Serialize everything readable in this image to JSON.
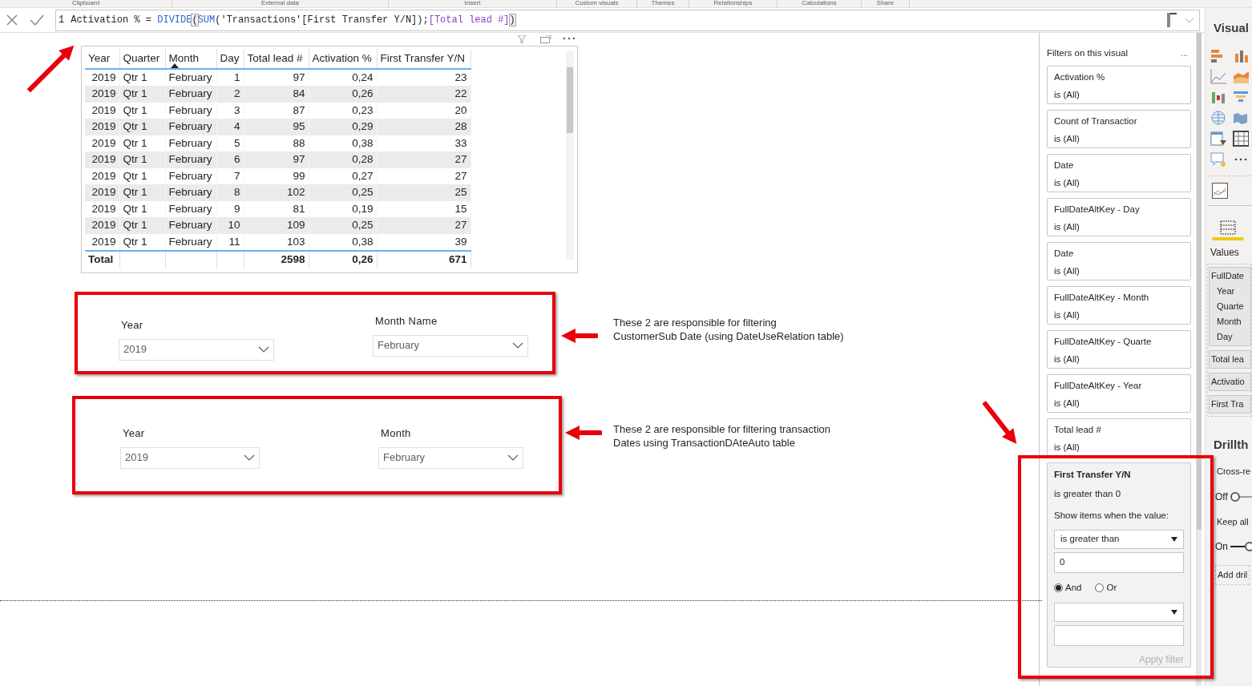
{
  "ribbon_groups": [
    "Clipboard",
    "External data",
    "Insert",
    "Custom visuals",
    "Themes",
    "Relationships",
    "Calculations",
    "Share"
  ],
  "formula": {
    "line_number": "1",
    "tokens": [
      {
        "kind": "plain",
        "text": "Activation % = "
      },
      {
        "kind": "function",
        "text": "DIVIDE"
      },
      {
        "kind": "matched",
        "text": "("
      },
      {
        "kind": "function",
        "text": "SUM"
      },
      {
        "kind": "plain",
        "text": "('Transactions'[First Transfer Y/N]);"
      },
      {
        "kind": "measure",
        "text": "[Total lead #]"
      },
      {
        "kind": "matched",
        "text": ")"
      }
    ]
  },
  "table": {
    "columns": [
      {
        "label": "Year",
        "kind": "number",
        "sorted": false
      },
      {
        "label": "Quarter",
        "kind": "text",
        "sorted": false
      },
      {
        "label": "Month",
        "kind": "text",
        "sorted": true
      },
      {
        "label": "Day",
        "kind": "number",
        "sorted": false
      },
      {
        "label": "Total lead #",
        "kind": "number",
        "sorted": false
      },
      {
        "label": "Activation %",
        "kind": "number",
        "sorted": false
      },
      {
        "label": "First Transfer Y/N",
        "kind": "number",
        "sorted": false
      }
    ],
    "rows": [
      [
        "2019",
        "Qtr 1",
        "February",
        "1",
        "97",
        "0,24",
        "23"
      ],
      [
        "2019",
        "Qtr 1",
        "February",
        "2",
        "84",
        "0,26",
        "22"
      ],
      [
        "2019",
        "Qtr 1",
        "February",
        "3",
        "87",
        "0,23",
        "20"
      ],
      [
        "2019",
        "Qtr 1",
        "February",
        "4",
        "95",
        "0,29",
        "28"
      ],
      [
        "2019",
        "Qtr 1",
        "February",
        "5",
        "88",
        "0,38",
        "33"
      ],
      [
        "2019",
        "Qtr 1",
        "February",
        "6",
        "97",
        "0,28",
        "27"
      ],
      [
        "2019",
        "Qtr 1",
        "February",
        "7",
        "99",
        "0,27",
        "27"
      ],
      [
        "2019",
        "Qtr 1",
        "February",
        "8",
        "102",
        "0,25",
        "25"
      ],
      [
        "2019",
        "Qtr 1",
        "February",
        "9",
        "81",
        "0,19",
        "15"
      ],
      [
        "2019",
        "Qtr 1",
        "February",
        "10",
        "109",
        "0,25",
        "27"
      ],
      [
        "2019",
        "Qtr 1",
        "February",
        "11",
        "103",
        "0,38",
        "39"
      ]
    ],
    "total": {
      "label": "Total",
      "values": [
        "2598",
        "0,26",
        "671"
      ]
    }
  },
  "slicer_groups": [
    {
      "slicers": [
        {
          "label": "Year",
          "value": "2019"
        },
        {
          "label": "Month Name",
          "value": "February"
        }
      ],
      "note": "These 2 are responsible for filtering\nCustomerSub Date (using DateUseRelation table)"
    },
    {
      "slicers": [
        {
          "label": "Year",
          "value": "2019"
        },
        {
          "label": "Month",
          "value": "February"
        }
      ],
      "note": "These 2 are responsible for filtering transaction\nDates using TransactionDAteAuto table"
    }
  ],
  "filters": {
    "title": "Filters on this visual",
    "more": "...",
    "cards": [
      {
        "field": "Activation %",
        "summary": "is (All)"
      },
      {
        "field": "Count of Transactior",
        "summary": "is (All)"
      },
      {
        "field": "Date",
        "summary": "is (All)"
      },
      {
        "field": "FullDateAltKey - Day",
        "summary": "is (All)"
      },
      {
        "field": "Date",
        "summary": "is (All)"
      },
      {
        "field": "FullDateAltKey - Month",
        "summary": "is (All)"
      },
      {
        "field": "FullDateAltKey - Quarte",
        "summary": "is (All)"
      },
      {
        "field": "FullDateAltKey - Year",
        "summary": "is (All)"
      },
      {
        "field": "Total lead #",
        "summary": "is (All)"
      }
    ],
    "expanded": {
      "field": "First Transfer Y/N",
      "summary": "is greater than 0",
      "prompt": "Show items when the value:",
      "condition": "is greater than",
      "value": "0",
      "logic": [
        {
          "label": "And",
          "selected": true
        },
        {
          "label": "Or",
          "selected": false
        }
      ],
      "apply": "Apply filter",
      "apply_disabled": true
    }
  },
  "visualizations": {
    "title": "Visual",
    "values_label": "Values",
    "fields": [
      {
        "label": "FullDate",
        "children": [
          {
            "label": "Year"
          },
          {
            "label": "Quarte"
          },
          {
            "label": "Month"
          },
          {
            "label": "Day"
          }
        ]
      },
      {
        "label": "Total lea"
      },
      {
        "label": "Activatio"
      },
      {
        "label": "First Tra"
      }
    ],
    "drillthrough_title": "Drillth",
    "cross_report": {
      "label": "Cross-re",
      "toggle": "Off",
      "on": false
    },
    "keep_all": {
      "label": "Keep all",
      "toggle": "On",
      "on": true
    },
    "add": "Add dril"
  }
}
